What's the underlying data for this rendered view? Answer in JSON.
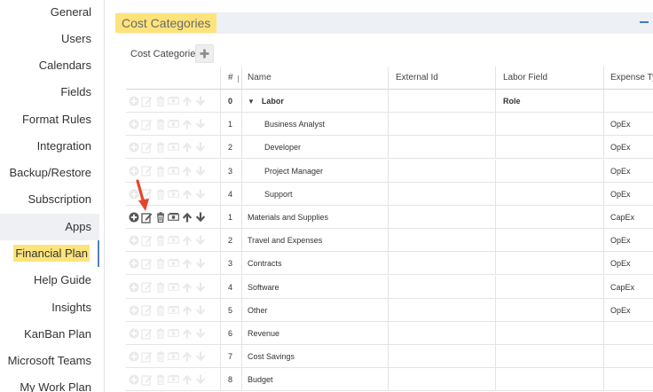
{
  "sidebar": {
    "items": [
      {
        "label": "General"
      },
      {
        "label": "Users"
      },
      {
        "label": "Calendars"
      },
      {
        "label": "Fields"
      },
      {
        "label": "Format Rules"
      },
      {
        "label": "Integration"
      },
      {
        "label": "Backup/Restore"
      },
      {
        "label": "Subscription"
      },
      {
        "label": "Apps"
      },
      {
        "label": "Financial Plan"
      },
      {
        "label": "Help Guide"
      },
      {
        "label": "Insights"
      },
      {
        "label": "KanBan Plan"
      },
      {
        "label": "Microsoft Teams"
      },
      {
        "label": "My Work Plan"
      }
    ],
    "selected": "Apps",
    "active": "Financial Plan"
  },
  "panel": {
    "title": "Cost Categories",
    "tab_label": "Cost Categories",
    "add_icon": "plus-icon",
    "collapse_icon": "minus-icon",
    "accent_color": "#3b7ec6",
    "highlight_color": "#fde37a"
  },
  "grid": {
    "columns": [
      "#",
      "Name",
      "External Id",
      "Labor Field",
      "Expense Typ"
    ],
    "rows": [
      {
        "num": "0",
        "name": "Labor",
        "external_id": "",
        "labor_field": "Role",
        "expense_type": ""
      },
      {
        "num": "1",
        "name": "Business Analyst",
        "external_id": "",
        "labor_field": "",
        "expense_type": "OpEx"
      },
      {
        "num": "2",
        "name": "Developer",
        "external_id": "",
        "labor_field": "",
        "expense_type": "OpEx"
      },
      {
        "num": "3",
        "name": "Project Manager",
        "external_id": "",
        "labor_field": "",
        "expense_type": "OpEx"
      },
      {
        "num": "4",
        "name": "Support",
        "external_id": "",
        "labor_field": "",
        "expense_type": "OpEx"
      },
      {
        "num": "1",
        "name": "Materials and Supplies",
        "external_id": "",
        "labor_field": "",
        "expense_type": "CapEx"
      },
      {
        "num": "2",
        "name": "Travel and Expenses",
        "external_id": "",
        "labor_field": "",
        "expense_type": "OpEx"
      },
      {
        "num": "3",
        "name": "Contracts",
        "external_id": "",
        "labor_field": "",
        "expense_type": "OpEx"
      },
      {
        "num": "4",
        "name": "Software",
        "external_id": "",
        "labor_field": "",
        "expense_type": "CapEx"
      },
      {
        "num": "5",
        "name": "Other",
        "external_id": "",
        "labor_field": "",
        "expense_type": "OpEx"
      },
      {
        "num": "6",
        "name": "Revenue",
        "external_id": "",
        "labor_field": "",
        "expense_type": ""
      },
      {
        "num": "7",
        "name": "Cost Savings",
        "external_id": "",
        "labor_field": "",
        "expense_type": ""
      },
      {
        "num": "8",
        "name": "Budget",
        "external_id": "",
        "labor_field": "",
        "expense_type": ""
      }
    ],
    "row_action_icons": [
      "add-circle-icon",
      "edit-icon",
      "delete-icon",
      "money-icon",
      "move-up-icon",
      "move-down-icon"
    ],
    "hovered_row": "Materials and Supplies"
  },
  "annotation": {
    "arrow_color": "#e8442c",
    "points_to": "edit-icon"
  }
}
